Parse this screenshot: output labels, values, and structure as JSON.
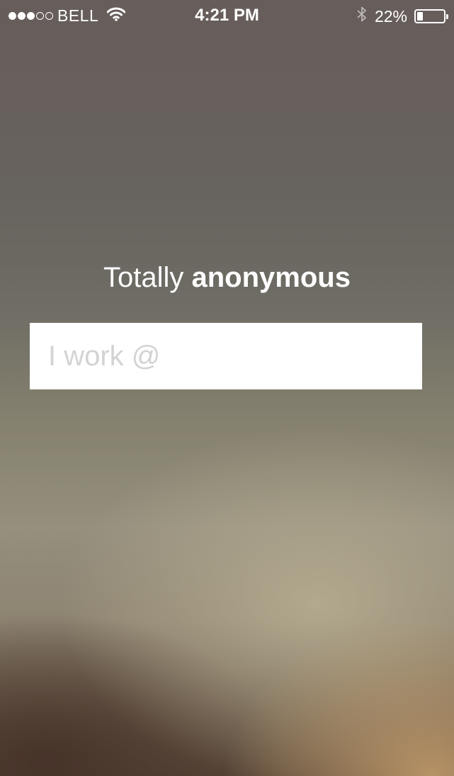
{
  "status_bar": {
    "carrier": "BELL",
    "signal_bars_filled": 3,
    "signal_bars_total": 5,
    "wifi_icon": "wifi-icon",
    "time": "4:21 PM",
    "bluetooth_icon": "bluetooth-icon",
    "battery_percent_label": "22%",
    "battery_level": 0.22
  },
  "main": {
    "headline_regular": "Totally ",
    "headline_bold": "anonymous",
    "workplace_input": {
      "placeholder": "I work @",
      "value": ""
    }
  },
  "colors": {
    "text": "#ffffff",
    "input_background": "#ffffff",
    "placeholder": "#d3d3d3"
  }
}
